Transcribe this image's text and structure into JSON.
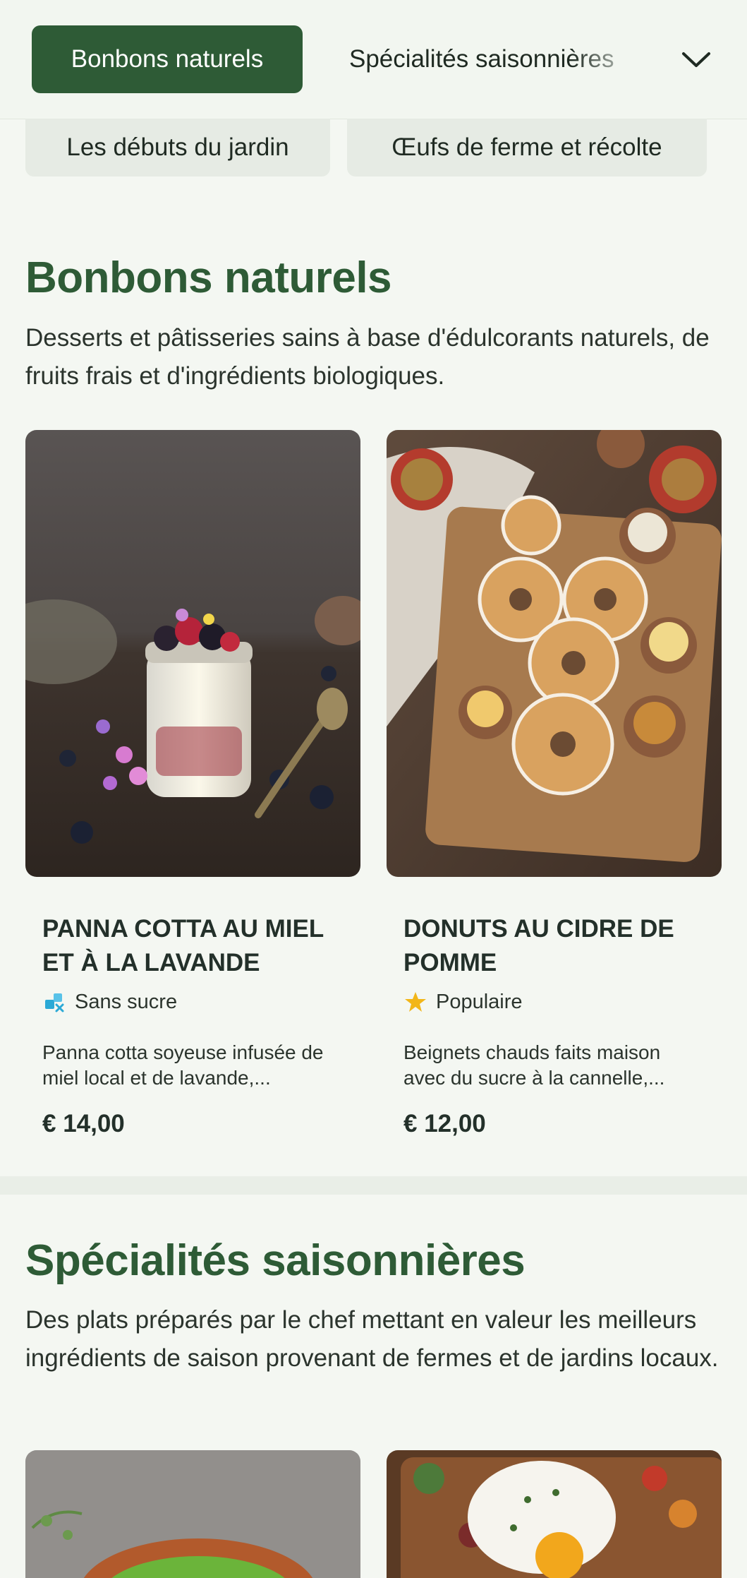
{
  "nav": {
    "active_tab": "Bonbons naturels",
    "next_tab": "Spécialités saisonnières",
    "sub_tabs": [
      "Les débuts du jardin",
      "Œufs de ferme et récolte"
    ]
  },
  "sections": [
    {
      "title": "Bonbons naturels",
      "description": "Desserts et pâtisseries sains à base d'édulcorants naturels, de fruits frais et d'ingrédients biologiques.",
      "items": [
        {
          "name": "Panna cotta au miel et à la lavande",
          "tag_icon": "sugar-free-icon",
          "tag": "Sans sucre",
          "description": "Panna cotta soyeuse infusée de miel local et de lavande,...",
          "price": "€ 14,00"
        },
        {
          "name": "Donuts au cidre de pomme",
          "tag_icon": "star-icon",
          "tag": "Populaire",
          "description": "Beignets chauds faits maison avec du sucre à la cannelle,...",
          "price": "€ 12,00"
        }
      ]
    },
    {
      "title": "Spécialités saisonnières",
      "description": "Des plats préparés par le chef mettant en valeur les meilleurs ingrédients de saison provenant de fermes et de jardins locaux."
    }
  ],
  "colors": {
    "brand": "#2e5b36",
    "background": "#f4f7f2",
    "star": "#f2b619",
    "sugar_free": "#2aa9d6"
  }
}
